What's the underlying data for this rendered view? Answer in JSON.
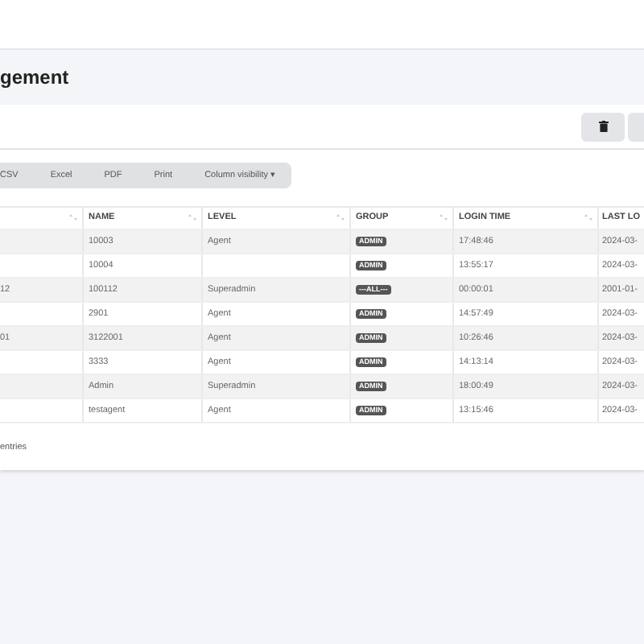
{
  "page_title": "gement",
  "toolbar": {
    "buttons": [
      {
        "kind": "delete"
      }
    ]
  },
  "export_buttons": [
    "CSV",
    "Excel",
    "PDF",
    "Print",
    "Column visibility ▾"
  ],
  "table": {
    "columns": [
      "",
      "NAME",
      "LEVEL",
      "GROUP",
      "LOGIN TIME",
      "LAST LO"
    ],
    "rows": [
      {
        "column_1": "",
        "name": "10003",
        "level": "Agent",
        "group": "ADMIN",
        "login_time": "17:48:46",
        "last_login": "2024-03-"
      },
      {
        "column_1": "",
        "name": "10004",
        "level": "",
        "group": "ADMIN",
        "login_time": "13:55:17",
        "last_login": "2024-03-"
      },
      {
        "column_1": "12",
        "name": "100112",
        "level": "Superadmin",
        "group": "---ALL---",
        "login_time": "00:00:01",
        "last_login": "2001-01-"
      },
      {
        "column_1": "",
        "name": "2901",
        "level": "Agent",
        "group": "ADMIN",
        "login_time": "14:57:49",
        "last_login": "2024-03-"
      },
      {
        "column_1": "01",
        "name": "3122001",
        "level": "Agent",
        "group": "ADMIN",
        "login_time": "10:26:46",
        "last_login": "2024-03-"
      },
      {
        "column_1": "",
        "name": "3333",
        "level": "Agent",
        "group": "ADMIN",
        "login_time": "14:13:14",
        "last_login": "2024-03-"
      },
      {
        "column_1": "",
        "name": "Admin",
        "level": "Superadmin",
        "group": "ADMIN",
        "login_time": "18:00:49",
        "last_login": "2024-03-"
      },
      {
        "column_1": "",
        "name": "testagent",
        "level": "Agent",
        "group": "ADMIN",
        "login_time": "13:15:46",
        "last_login": "2024-03-"
      }
    ]
  },
  "footer": "entries"
}
